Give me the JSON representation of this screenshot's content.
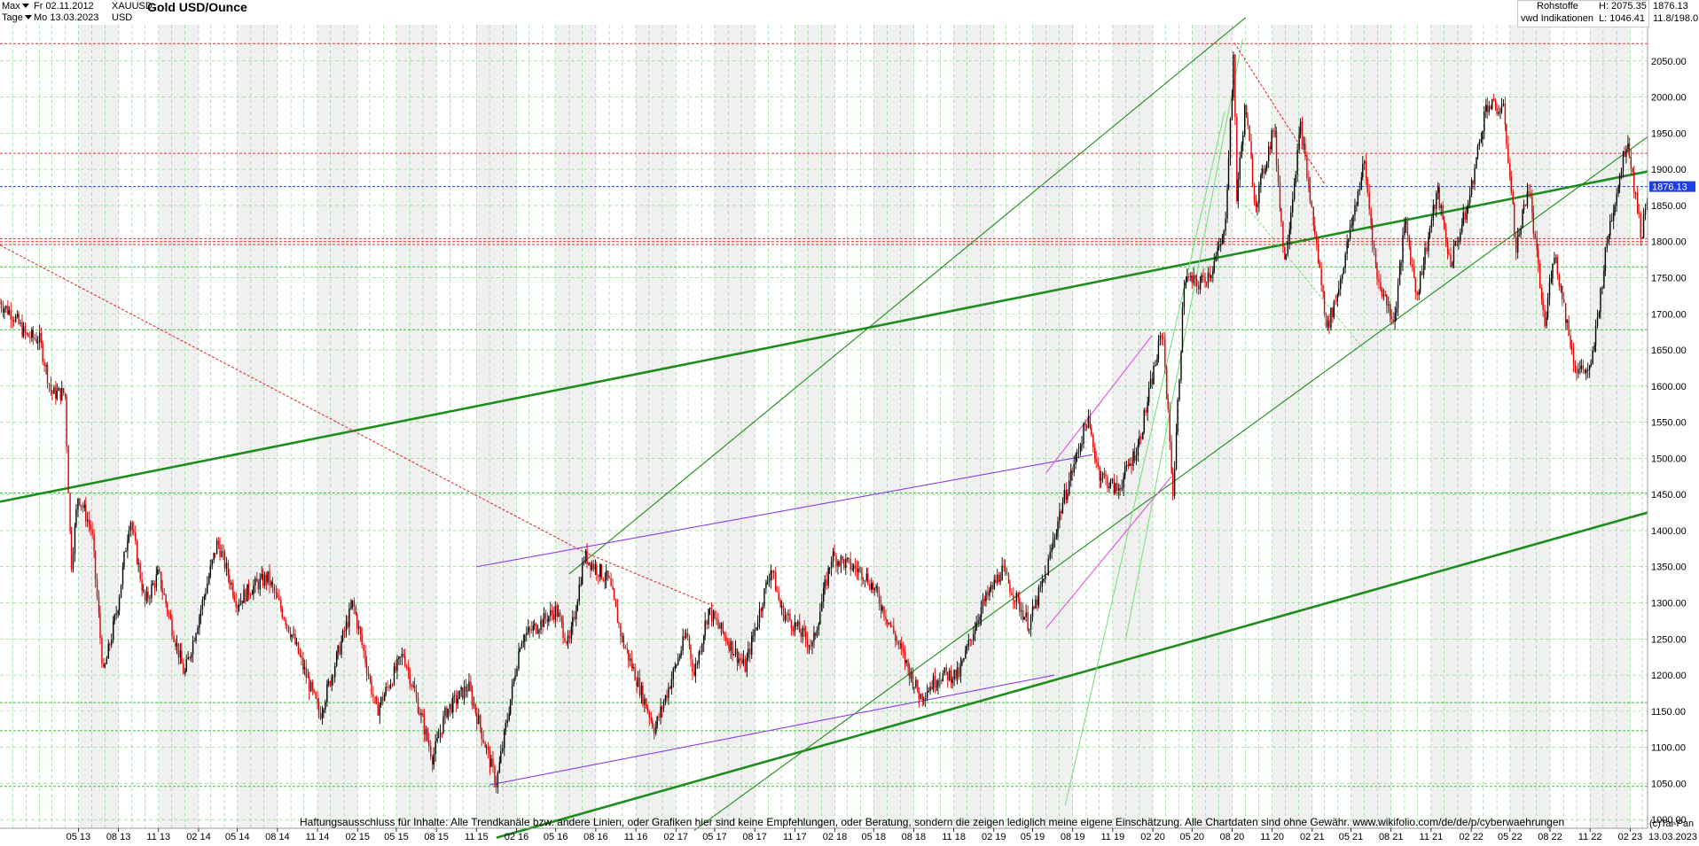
{
  "header": {
    "range_label": "Max",
    "from_date": "Fr 02.11.2012",
    "interval_label": "Tage",
    "to_date": "Mo 13.03.2023",
    "symbol": "XAUUSD",
    "currency": "USD",
    "title": "Gold USD/Ounce",
    "category": "Rohstoffe",
    "source": "vwd Indikationen",
    "high": "H: 2075.35",
    "low": "L: 1046.41",
    "last": "1876.13",
    "ratio": "11.8/198.0"
  },
  "disclaimer": "Haftungsausschluss für Inhalte: Alle Trendkanäle bzw. andere Linien, oder Grafiken hier sind keine Empfehlungen, oder Beratung, sondern die zeigen lediglich meine eigene Einschätzung. Alle Chartdaten sind ohne Gewähr.  www.wikifolio.com/de/de/p/cyberwaehrungen",
  "copyright": "(c)Tai-Pan",
  "colors": {
    "background": "#ffffff",
    "band": "#f0f0f0",
    "grid": "#7ed67e",
    "up_candle": "#000000",
    "down_candle": "#e00000",
    "trend_dark": "#1e8c1e",
    "trend_light": "#7ee07e",
    "channel_purple": "#8a3cf0",
    "channel_magenta": "#e050e0",
    "support_red": "#e03030",
    "last_blue": "#1f3fe0"
  },
  "chart_data": {
    "type": "line",
    "style": "candlestick",
    "title": "Gold USD/Ounce",
    "xlabel": "",
    "ylabel": "",
    "ylim": [
      988,
      2100
    ],
    "x_range": [
      "2012-11-02",
      "2023-03-13"
    ],
    "y_ticks": [
      1000,
      1050,
      1100,
      1150,
      1200,
      1250,
      1300,
      1350,
      1400,
      1450,
      1500,
      1550,
      1600,
      1650,
      1700,
      1750,
      1800,
      1850,
      1900,
      1950,
      2000,
      2050
    ],
    "x_tick_labels": [
      "05 13",
      "08 13",
      "11 13",
      "02 14",
      "05 14",
      "08 14",
      "11 14",
      "02 15",
      "05 15",
      "08 15",
      "11 15",
      "02 16",
      "05 16",
      "08 16",
      "11 16",
      "02 17",
      "05 17",
      "08 17",
      "11 17",
      "02 18",
      "05 18",
      "08 18",
      "11 18",
      "02 19",
      "05 19",
      "08 19",
      "11 19",
      "02 20",
      "05 20",
      "08 20",
      "11 20",
      "02 21",
      "05 21",
      "08 21",
      "11 21",
      "02 22",
      "05 22",
      "08 22",
      "11 22",
      "02 23"
    ],
    "x_tick_dates": [
      "2013-05-01",
      "2013-08-01",
      "2013-11-01",
      "2014-02-01",
      "2014-05-01",
      "2014-08-01",
      "2014-11-01",
      "2015-02-01",
      "2015-05-01",
      "2015-08-01",
      "2015-11-01",
      "2016-02-01",
      "2016-05-01",
      "2016-08-01",
      "2016-11-01",
      "2017-02-01",
      "2017-05-01",
      "2017-08-01",
      "2017-11-01",
      "2018-02-01",
      "2018-05-01",
      "2018-08-01",
      "2018-11-01",
      "2019-02-01",
      "2019-05-01",
      "2019-08-01",
      "2019-11-01",
      "2020-02-01",
      "2020-05-01",
      "2020-08-01",
      "2020-11-01",
      "2021-02-01",
      "2021-05-01",
      "2021-08-01",
      "2021-11-01",
      "2022-02-01",
      "2022-05-01",
      "2022-08-01",
      "2022-11-01",
      "2023-02-01"
    ],
    "last_price": 1876.13,
    "last_price_label": "1876.13",
    "end_date_label": "13.03.2023",
    "grid": true,
    "series": [
      {
        "x": [
          "2012-11-02",
          "2012-12-01",
          "2013-01-01",
          "2013-02-01",
          "2013-03-01",
          "2013-04-01",
          "2013-04-15",
          "2013-05-01",
          "2013-06-01",
          "2013-06-28",
          "2013-08-01",
          "2013-08-28",
          "2013-10-01",
          "2013-11-01",
          "2013-12-31",
          "2014-03-17",
          "2014-05-01",
          "2014-06-01",
          "2014-07-10",
          "2014-09-01",
          "2014-11-07",
          "2015-01-22",
          "2015-03-17",
          "2015-05-18",
          "2015-07-24",
          "2015-08-24",
          "2015-10-14",
          "2015-12-17",
          "2016-02-11",
          "2016-05-02",
          "2016-06-01",
          "2016-07-06",
          "2016-09-01",
          "2016-10-01",
          "2016-12-15",
          "2017-02-27",
          "2017-03-15",
          "2017-04-17",
          "2017-07-10",
          "2017-09-08",
          "2017-10-01",
          "2017-12-12",
          "2018-01-25",
          "2018-04-11",
          "2018-05-01",
          "2018-06-01",
          "2018-08-16",
          "2018-10-01",
          "2018-11-13",
          "2019-01-01",
          "2019-02-20",
          "2019-04-23",
          "2019-06-01",
          "2019-07-01",
          "2019-09-04",
          "2019-10-01",
          "2019-11-12",
          "2019-12-31",
          "2020-02-24",
          "2020-03-19",
          "2020-04-14",
          "2020-05-15",
          "2020-06-15",
          "2020-07-15",
          "2020-08-06",
          "2020-08-12",
          "2020-09-01",
          "2020-09-24",
          "2020-11-06",
          "2020-11-30",
          "2021-01-06",
          "2021-03-08",
          "2021-04-01",
          "2021-06-01",
          "2021-06-30",
          "2021-08-09",
          "2021-09-03",
          "2021-09-29",
          "2021-11-16",
          "2021-12-15",
          "2022-01-25",
          "2022-03-08",
          "2022-04-18",
          "2022-05-16",
          "2022-06-13",
          "2022-07-21",
          "2022-08-10",
          "2022-09-28",
          "2022-11-03",
          "2022-12-13",
          "2023-01-26",
          "2023-02-28",
          "2023-03-13"
        ],
        "y": [
          1715,
          1700,
          1670,
          1665,
          1590,
          1590,
          1350,
          1450,
          1400,
          1200,
          1300,
          1420,
          1300,
          1340,
          1200,
          1385,
          1300,
          1320,
          1335,
          1260,
          1145,
          1300,
          1150,
          1230,
          1085,
          1150,
          1185,
          1050,
          1250,
          1290,
          1240,
          1365,
          1330,
          1250,
          1125,
          1260,
          1200,
          1290,
          1210,
          1350,
          1290,
          1240,
          1365,
          1340,
          1320,
          1280,
          1170,
          1200,
          1200,
          1290,
          1345,
          1270,
          1340,
          1420,
          1555,
          1480,
          1455,
          1520,
          1680,
          1450,
          1750,
          1740,
          1760,
          1810,
          2060,
          1860,
          1990,
          1850,
          1960,
          1770,
          1960,
          1680,
          1730,
          1910,
          1750,
          1690,
          1830,
          1725,
          1870,
          1770,
          1850,
          1990,
          1980,
          1790,
          1880,
          1680,
          1790,
          1625,
          1620,
          1810,
          1945,
          1805,
          1870
        ]
      }
    ],
    "annotation_lines": [
      {
        "name": "long-term support (thick)",
        "color": "dark-green",
        "from": [
          "2012-11-02",
          1440
        ],
        "to": [
          "2023-03-13",
          1897
        ]
      },
      {
        "name": "long-term support (thick)",
        "color": "dark-green",
        "from": [
          "2015-12-17",
          975
        ],
        "to": [
          "2023-03-13",
          1425
        ]
      },
      {
        "name": "rising channel upper",
        "color": "dark-green",
        "from": [
          "2016-06-01",
          1340
        ],
        "to": [
          "2020-09-01",
          2110
        ]
      },
      {
        "name": "rising channel lower",
        "color": "dark-green",
        "from": [
          "2017-03-15",
          985
        ],
        "to": [
          "2023-03-13",
          1945
        ]
      },
      {
        "name": "steep channel",
        "color": "light-green",
        "from": [
          "2019-07-15",
          1020
        ],
        "to": [
          "2020-07-15",
          1980
        ]
      },
      {
        "name": "steep channel",
        "color": "light-green",
        "from": [
          "2019-12-01",
          1250
        ],
        "to": [
          "2020-08-25",
          2080
        ]
      },
      {
        "name": "purple channel upper",
        "color": "purple",
        "from": [
          "2015-11-01",
          1350
        ],
        "to": [
          "2019-09-15",
          1505
        ]
      },
      {
        "name": "purple channel lower",
        "color": "purple",
        "from": [
          "2015-12-01",
          1048
        ],
        "to": [
          "2019-06-20",
          1200
        ]
      },
      {
        "name": "magenta channel upper",
        "color": "magenta",
        "from": [
          "2019-06-01",
          1480
        ],
        "to": [
          "2020-01-30",
          1670
        ]
      },
      {
        "name": "magenta channel lower",
        "color": "magenta",
        "from": [
          "2019-06-01",
          1265
        ],
        "to": [
          "2020-03-15",
          1475
        ]
      },
      {
        "name": "dotted downtrend",
        "color": "red",
        "from": [
          "2012-11-02",
          1795
        ],
        "to": [
          "2016-07-06",
          1370
        ]
      },
      {
        "name": "dotted downtrend",
        "color": "red",
        "from": [
          "2020-08-06",
          2075
        ],
        "to": [
          "2021-03-01",
          1880
        ]
      },
      {
        "name": "dotted fan",
        "color": "red",
        "from": [
          "2016-07-06",
          1370
        ],
        "to": [
          "2017-05-01",
          1295
        ]
      },
      {
        "name": "dotted fan",
        "color": "light-green",
        "from": [
          "2020-09-01",
          1850
        ],
        "to": [
          "2021-06-01",
          1650
        ]
      }
    ],
    "horizontal_levels": [
      {
        "value": 2074,
        "color": "red",
        "style": "dotted"
      },
      {
        "value": 1922,
        "color": "red",
        "style": "dotted"
      },
      {
        "value": 1876.13,
        "color": "blue",
        "style": "dotted"
      },
      {
        "value": 1804,
        "color": "red",
        "style": "dotted"
      },
      {
        "value": 1800,
        "color": "red",
        "style": "dotted"
      },
      {
        "value": 1796,
        "color": "red",
        "style": "dotted"
      },
      {
        "value": 1765,
        "color": "light-green",
        "style": "dotted"
      },
      {
        "value": 1678,
        "color": "light-green",
        "style": "dotted"
      },
      {
        "value": 1452,
        "color": "light-green",
        "style": "dotted"
      },
      {
        "value": 1162,
        "color": "light-green",
        "style": "dotted"
      },
      {
        "value": 1123,
        "color": "light-green",
        "style": "dotted"
      },
      {
        "value": 1046,
        "color": "light-green",
        "style": "dotted"
      }
    ]
  }
}
